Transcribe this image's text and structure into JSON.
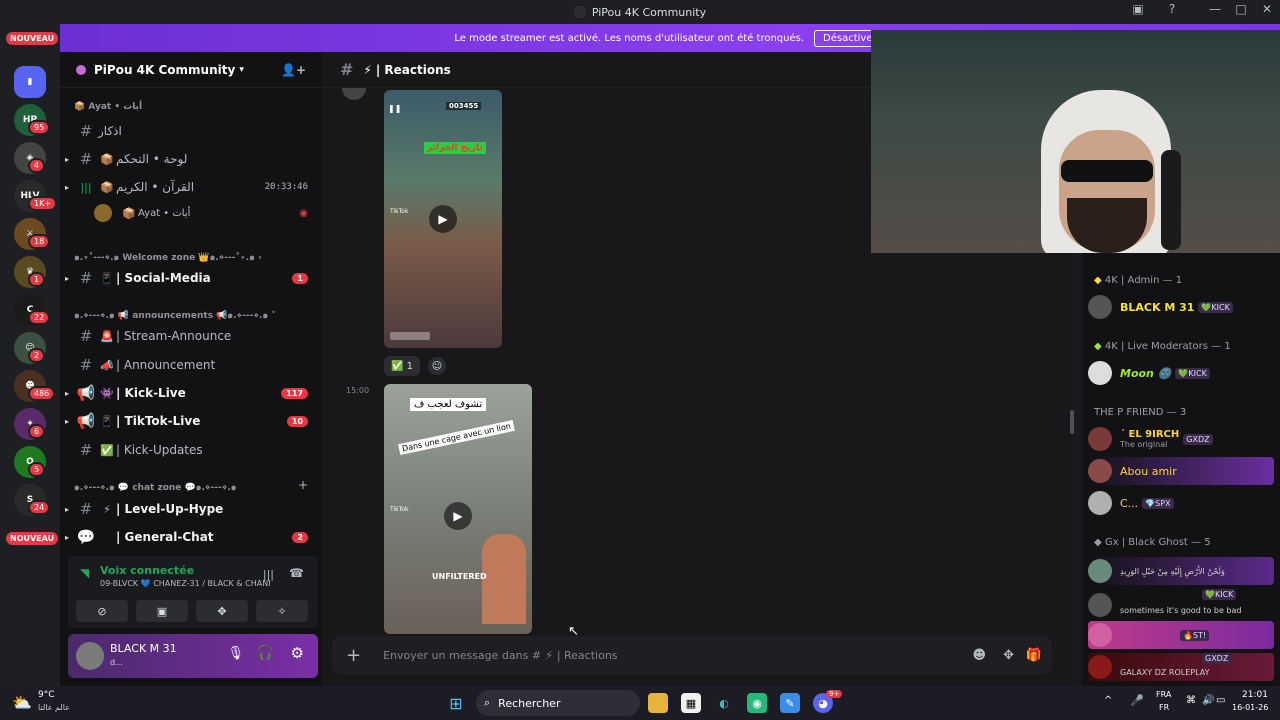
{
  "window": {
    "title": "PiPou 4K Community"
  },
  "banner": {
    "text": "Le mode streamer est activé. Les noms d'utilisateur ont été tronqués.",
    "button": "Désactiver"
  },
  "rail": {
    "nouveau_top": "NOUVEAU",
    "nouveau_bottom": "NOUVEAU",
    "badges": [
      "95",
      "4",
      "1K+",
      "18",
      "1",
      "22",
      "2",
      "486",
      "6",
      "5",
      "24"
    ],
    "labels": {
      "hv": "HLV"
    }
  },
  "server": {
    "name": "PiPou 4K Community"
  },
  "channels": {
    "top_cat": "Ayat • أيات",
    "items": [
      {
        "label": "اذكار",
        "emoji": "",
        "badge": ""
      },
      {
        "label": "لوحة • التحكم",
        "emoji": "📦",
        "badge": ""
      },
      {
        "label": "القرآن • الكريم",
        "emoji": "📦",
        "time": "20:33:46",
        "badge": ""
      },
      {
        "label": "Ayat • أيات",
        "emoji": "📦",
        "badge": ""
      }
    ],
    "cat_welcome": "๑.⋆˚---⋄.๑ Welcome zone 👑๑.⋄---˚⋆.๑",
    "social": {
      "label": "| Social-Media",
      "emoji": "📱",
      "badge": "1"
    },
    "cat_announce": "๑.⋄---⋄.๑ 📢 announcements 📢๑.⋄---⋄.๑",
    "announce_items": [
      {
        "label": "| Stream-Announce",
        "emoji": "🚨",
        "badge": ""
      },
      {
        "label": "| Announcement",
        "emoji": "📣",
        "badge": ""
      },
      {
        "label": "| Kick-Live",
        "emoji": "👾",
        "badge": "117"
      },
      {
        "label": "| TikTok-Live",
        "emoji": "📱",
        "badge": "10"
      },
      {
        "label": "| Kick-Updates",
        "emoji": "✅",
        "badge": ""
      }
    ],
    "cat_chat": "๑.⋄---⋄.๑ 💬 chat zone 💬๑.⋄---⋄.๑",
    "chat_items": [
      {
        "label": "| Level-Up-Hype",
        "emoji": "⚡",
        "badge": ""
      },
      {
        "label": "| General-Chat",
        "emoji": "💬",
        "badge": "2"
      }
    ]
  },
  "voice": {
    "status": "Voix connectée",
    "channel": "09-BLVCK 💙 CHANEZ-31 / BLACK & CHANEZ G..."
  },
  "user": {
    "name": "BLACK M 31",
    "status": "d..."
  },
  "chat": {
    "channel": "| Reactions",
    "reaction_count": "1",
    "time_second": "15:00",
    "video1": {
      "score": "003455",
      "overlay_text": "تاريخ الجزائر",
      "watermark": "TikTok"
    },
    "video2": {
      "caption1": "تشوف لعجب ف",
      "caption2": "Dans une cage avec un lion",
      "label": "UNFILTERED",
      "watermark": "TikTok"
    },
    "composer_placeholder": "Envoyer un message dans #",
    "composer_channel": "| Reactions"
  },
  "members": {
    "groups": [
      {
        "title": "4K | Admin — 1",
        "members": [
          {
            "name": "BLACK M 31",
            "tag": "💚KICK",
            "color": "#f5e23b"
          }
        ]
      },
      {
        "title": "4K | Live Moderators — 1",
        "members": [
          {
            "name": "Moon 🌚",
            "tag": "💚KICK",
            "color": "#a3e635"
          }
        ]
      },
      {
        "title": "THE P FRIEND — 3",
        "members": [
          {
            "name": "´ EL 9IRCH",
            "sub": "The original",
            "tag": "GXDZ",
            "color": "#ffd43b"
          },
          {
            "name": "Abou amir",
            "tag": "",
            "color": "#ffd43b"
          },
          {
            "name": "C...",
            "tag": "💎SPX",
            "color": "#ffd43b"
          }
        ]
      },
      {
        "title": "Gx | Black Ghost — 5",
        "members": [
          {
            "name": "وَلَحْنٌ الأَرْضِ إِلَيْهِ مِنْ حَبْلِ الوَرِيدِ",
            "tag": "",
            "color": "#cfcfcf"
          },
          {
            "name": "sometimes it's good to be bad",
            "tag": "💚KICK",
            "color": "#cfcfcf"
          },
          {
            "name": "",
            "tag": "🔥ST!",
            "color": "#cfcfcf"
          },
          {
            "name": "GALAXY DZ ROLEPLAY",
            "tag": "GXDZ",
            "color": "#cfcfcf"
          }
        ]
      }
    ]
  },
  "taskbar": {
    "weather_temp": "9°C",
    "weather_desc": "عالم عالتا",
    "search": "Rechercher",
    "lang1": "FRA",
    "lang2": "FR",
    "time": "21:01",
    "date": "16-01-26",
    "discord_badge": "9+"
  },
  "colors": {
    "accent": "#8a3ff0",
    "badge": "#e63946"
  }
}
